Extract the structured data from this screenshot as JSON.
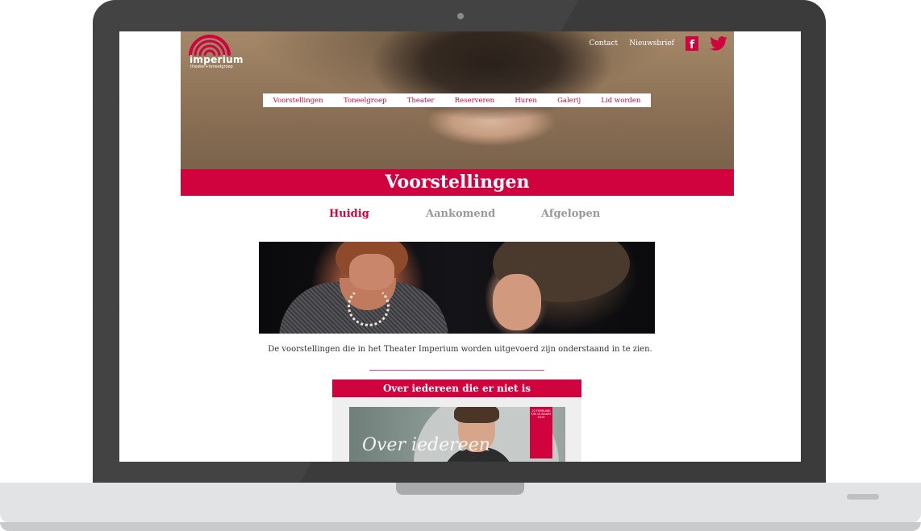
{
  "site": {
    "logo_text": "imperium",
    "logo_sub": "theater+toneelgroep",
    "top_links": [
      "Contact",
      "Nieuwsbrief"
    ],
    "nav": [
      "Voorstellingen",
      "Toneelgroep",
      "Theater",
      "Reserveren",
      "Huren",
      "Galerij",
      "Lid worden"
    ],
    "page_title": "Voorstellingen",
    "tabs": [
      "Huidig",
      "Aankomend",
      "Afgelopen"
    ],
    "intro": "De voorstellingen die in het Theater Imperium worden uitgevoerd zijn onderstaand in te zien.",
    "card_title": "Over iedereen die er niet is",
    "poster_text": "Over iedereen",
    "poster_ribbon": "22 FEBRUARI T/M 10 MAART 2019"
  },
  "colors": {
    "accent": "#d1033f",
    "inactive_tab": "#999999",
    "laptop_frame": "#3b3b3b"
  },
  "icons": [
    "facebook-icon",
    "twitter-icon",
    "imperium-logo"
  ]
}
